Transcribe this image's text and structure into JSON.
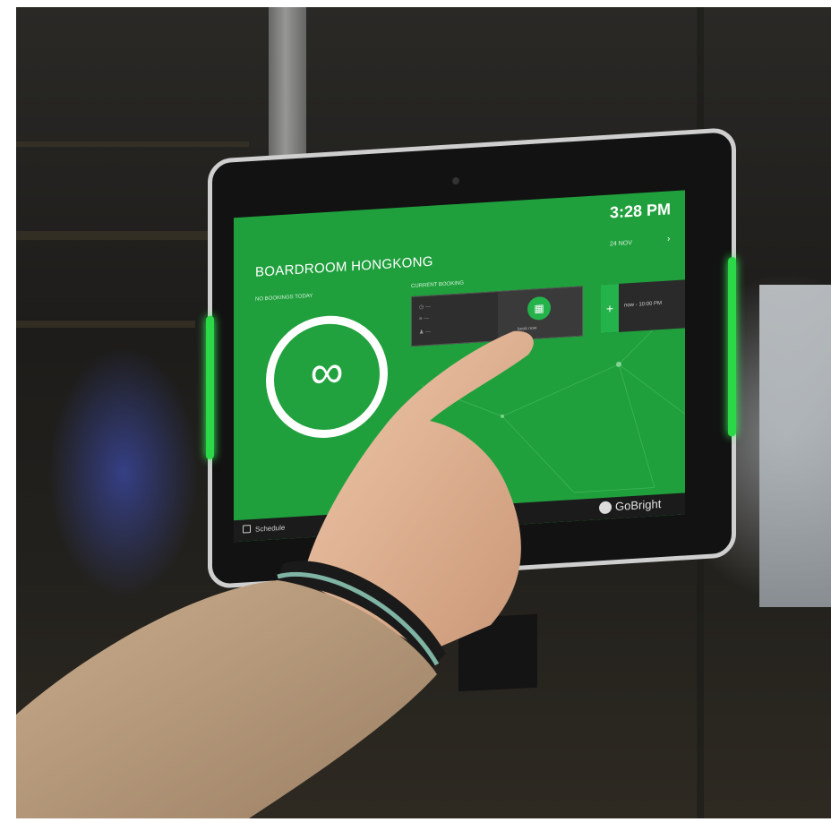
{
  "scene": {
    "accent_green": "#20a03d",
    "led_color": "#2bd848",
    "icons": [
      "infinity-icon",
      "calendar-icon",
      "plus-icon",
      "schedule-icon",
      "gobright-logo-icon",
      "chevron-right-icon"
    ]
  },
  "screen": {
    "room_name": "BOARDROOM HONGKONG",
    "no_bookings_label": "NO BOOKINGS TODAY",
    "time": "3:28 PM",
    "date": "24 NOV",
    "date_arrow": "›",
    "current_booking_label": "CURRENT BOOKING",
    "availability_symbol": "∞",
    "book_label": "book now",
    "plus_label": "+",
    "next_slot": "now - 10:00 PM",
    "schedule_label": "Schedule",
    "brand": "GoBright"
  }
}
